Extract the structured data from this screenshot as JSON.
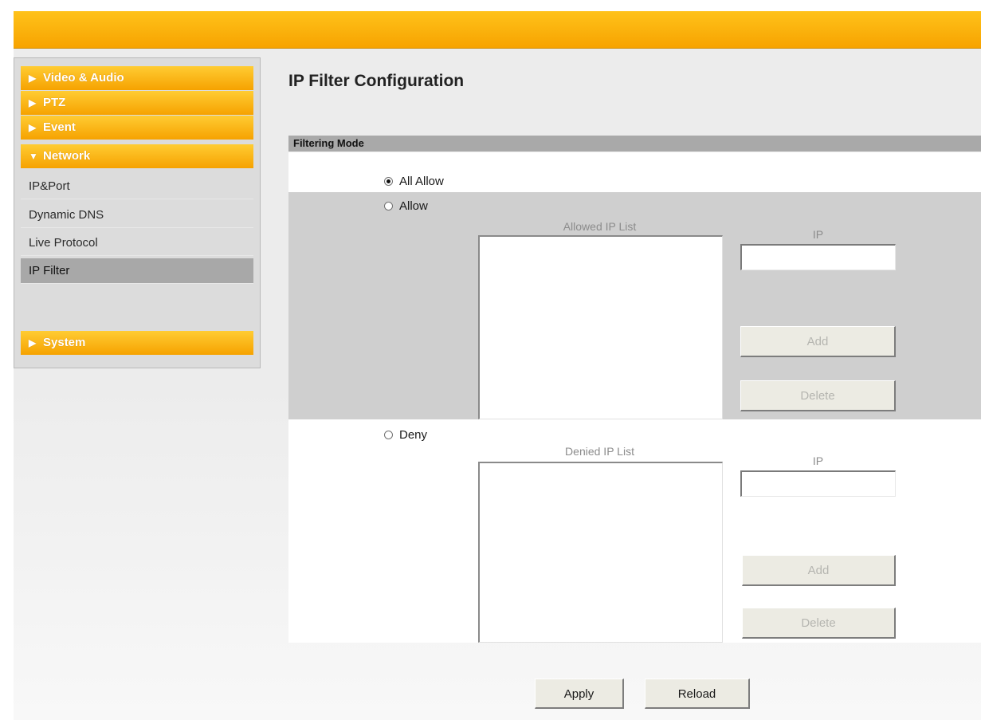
{
  "sidebar": {
    "menus": [
      {
        "label": "Video & Audio",
        "arrow": "▶"
      },
      {
        "label": "PTZ",
        "arrow": "▶"
      },
      {
        "label": "Event",
        "arrow": "▶"
      },
      {
        "label": "Network",
        "arrow": "▼"
      }
    ],
    "network_items": [
      "IP&Port",
      "Dynamic DNS",
      "Live Protocol",
      "IP Filter"
    ],
    "active_item": "IP Filter",
    "system": {
      "label": "System",
      "arrow": "▶"
    }
  },
  "main": {
    "title": "IP Filter Configuration",
    "section_label": "Filtering Mode",
    "mode_options": [
      "All Allow",
      "Allow",
      "Deny"
    ],
    "selected_mode": "All Allow",
    "allow": {
      "list_label": "Allowed IP List",
      "ip_label": "IP",
      "ip_value": "",
      "add_label": "Add",
      "delete_label": "Delete"
    },
    "deny": {
      "list_label": "Denied IP List",
      "ip_label": "IP",
      "ip_value": "",
      "add_label": "Add",
      "delete_label": "Delete"
    },
    "apply_label": "Apply",
    "reload_label": "Reload"
  },
  "colors": {
    "header_orange": "#f7a300",
    "menu_orange": "#ffb400",
    "active_item_bg": "#a8a8a8",
    "section_bar": "#a9a9a9"
  }
}
